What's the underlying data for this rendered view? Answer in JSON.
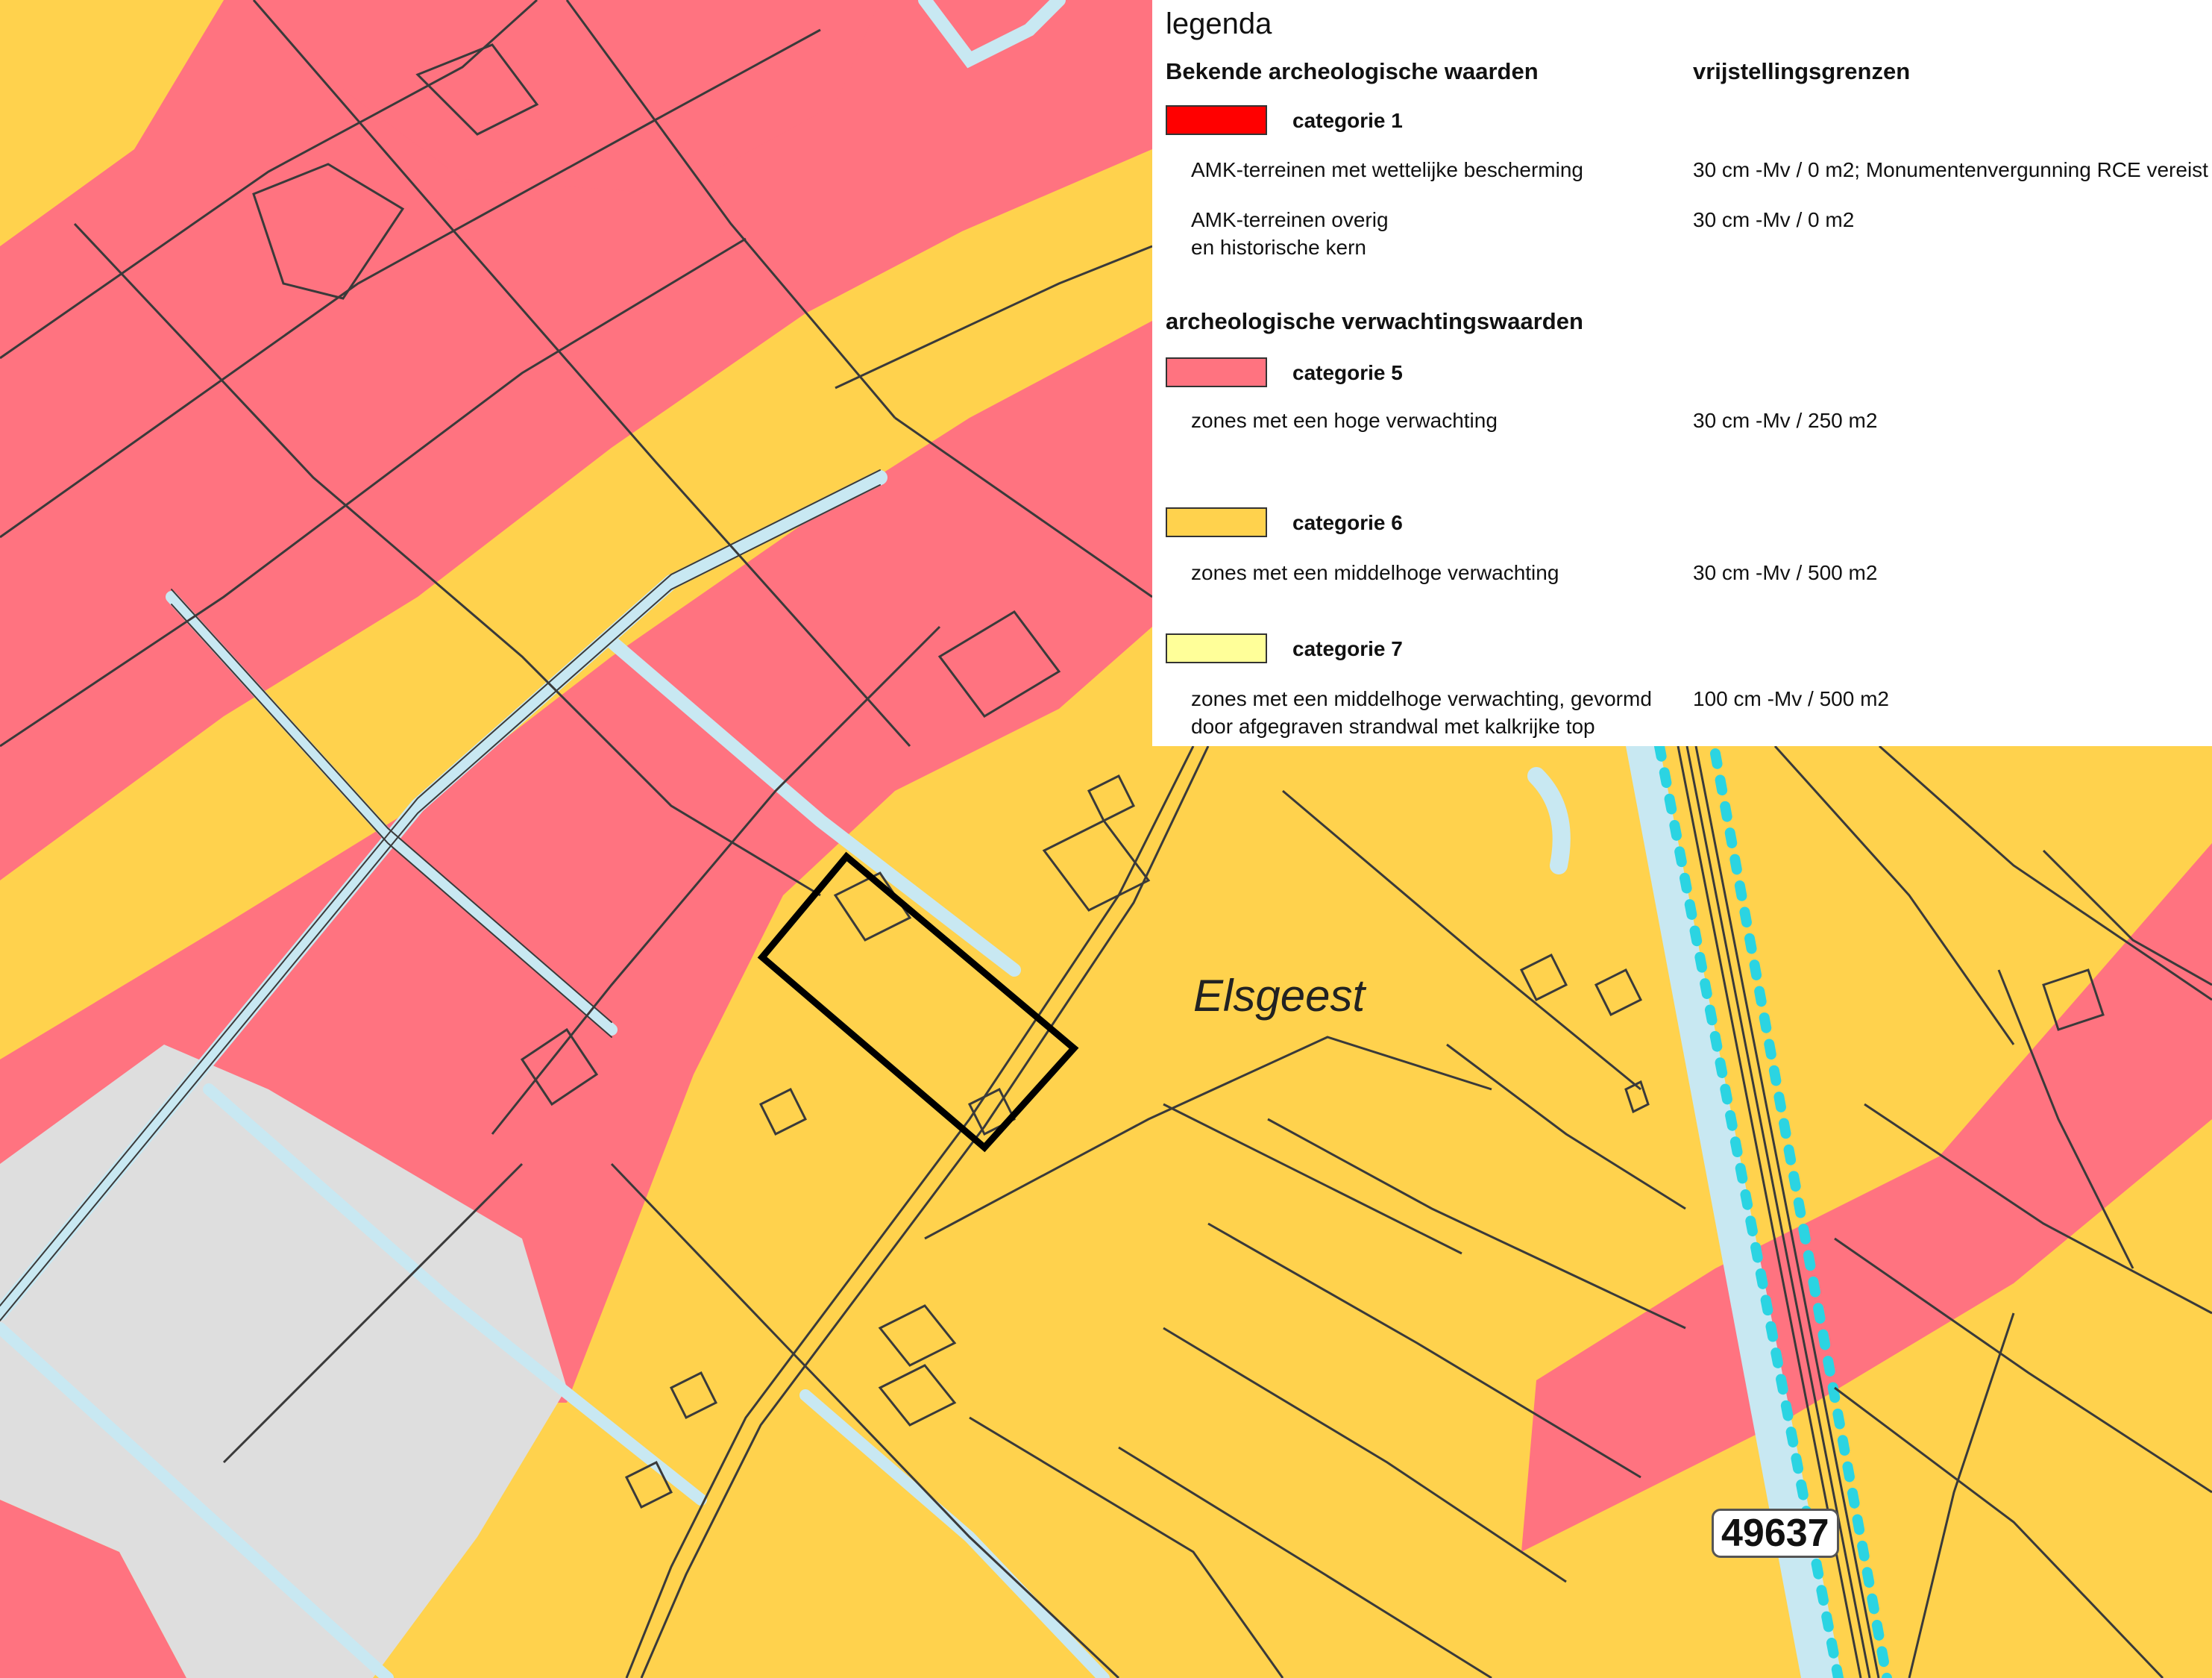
{
  "map": {
    "place_label": "Elsgeest",
    "road_number": "49637",
    "colors": {
      "cat1": "#ff0000",
      "cat5": "#ff7380",
      "cat6": "#ffd24d",
      "cat7": "#ffff99",
      "water": "#c8e8f2",
      "built_area": "#dedede",
      "parcel_lines": "#3a3a3a",
      "boundary": "#2bd4e2",
      "study_area": "#000000"
    }
  },
  "legend": {
    "title": "legenda",
    "section1_heading": "Bekende archeologische waarden",
    "column_heading": "vrijstellingsgrenzen",
    "cat1": {
      "label": "categorie 1",
      "rows": [
        {
          "desc": "AMK-terreinen met wettelijke bescherming",
          "limit": "30 cm -Mv / 0 m2; Monumentenvergunning RCE vereist"
        },
        {
          "desc_line1": "AMK-terreinen overig",
          "desc_line2": "en historische kern",
          "limit": "30 cm -Mv / 0 m2"
        }
      ]
    },
    "section2_heading": "archeologische verwachtingswaarden",
    "cat5": {
      "label": "categorie 5",
      "desc": "zones met een hoge verwachting",
      "limit": "30 cm -Mv / 250 m2"
    },
    "cat6": {
      "label": "categorie 6",
      "desc": "zones met een middelhoge verwachting",
      "limit": "30 cm -Mv / 500 m2"
    },
    "cat7": {
      "label": "categorie 7",
      "desc_line1": "zones met een middelhoge verwachting, gevormd",
      "desc_line2": "door afgegraven strandwal met kalkrijke top",
      "limit": "100 cm -Mv / 500 m2"
    }
  }
}
